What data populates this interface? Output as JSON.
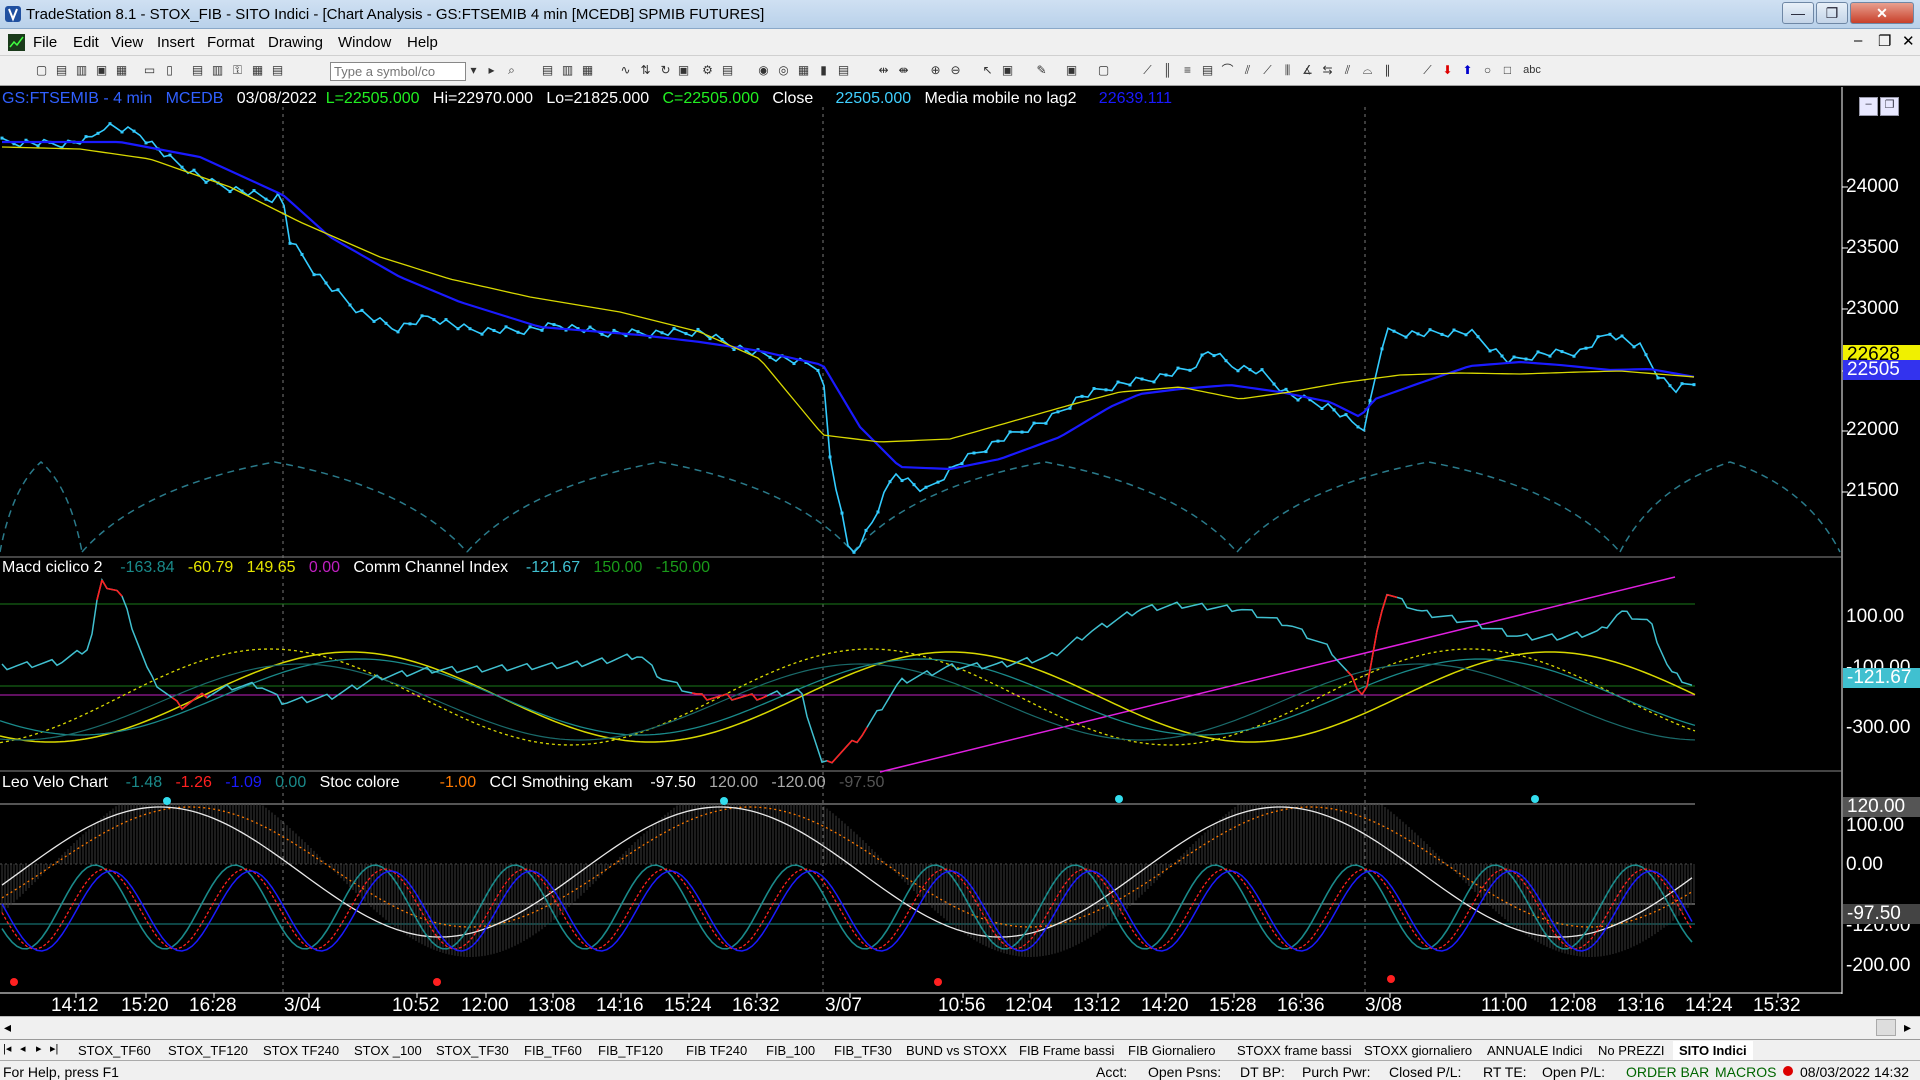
{
  "window": {
    "title": "TradeStation 8.1 - STOX_FIB - SITO Indici - [Chart Analysis - GS:FTSEMIB  4 min  [MCEDB] SPMIB FUTURES]",
    "min": "—",
    "max": "❐",
    "close": "✕",
    "child_min": "–",
    "child_restore": "❐",
    "child_close": "✕"
  },
  "menu": [
    "File",
    "Edit",
    "View",
    "Insert",
    "Format",
    "Drawing",
    "Window",
    "Help"
  ],
  "toolbar": {
    "symbol_placeholder": "Type a symbol/co"
  },
  "header": {
    "symbol": "GS:FTSEMIB - 4 min",
    "feed": "MCEDB",
    "date": "03/08/2022",
    "last": "L=22505.000",
    "hi": "Hi=22970.000",
    "lo": "Lo=21825.000",
    "close_eq": "C=22505.000",
    "close_label": "Close",
    "close_val": "22505.000",
    "ma_label": "Media mobile no lag2",
    "ma_val": "22639.111"
  },
  "panel2": {
    "name": "Macd ciclico 2",
    "v1": "-163.84",
    "v2": "-60.79",
    "v3": "149.65",
    "v4": "0.00",
    "cci_name": "Comm Channel Index",
    "cci1": "-121.67",
    "cci2": "150.00",
    "cci3": "-150.00"
  },
  "panel3": {
    "name": "Leo Velo Chart",
    "v1": "-1.48",
    "v2": "-1.26",
    "v3": "-1.09",
    "v4": "0.00",
    "stoc_name": "Stoc colore",
    "stoc_val": "-1.00",
    "cci_name": "CCI Smothing ekam",
    "c1": "-97.50",
    "c2": "120.00",
    "c3": "-120.00",
    "c4": "-97.50"
  },
  "price_axis": [
    "24000",
    "23500",
    "23000",
    "22500",
    "22000",
    "21500"
  ],
  "price_boxes": {
    "ma": "22628",
    "last": "22505"
  },
  "macd_axis": [
    "100.00",
    "-100.00",
    "-300.00"
  ],
  "macd_box": "-121.67",
  "velo_axis": [
    "120.00",
    "100.00",
    "0.00",
    "-120.00",
    "-200.00"
  ],
  "velo_box": "-97.50",
  "time_axis": [
    "14:12",
    "15:20",
    "16:28",
    "3/04",
    "10:52",
    "12:00",
    "13:08",
    "14:16",
    "15:24",
    "16:32",
    "3/07",
    "10:56",
    "12:04",
    "13:12",
    "14:20",
    "15:28",
    "16:36",
    "3/08",
    "11:00",
    "12:08",
    "13:16",
    "14:24",
    "15:32"
  ],
  "tabs": [
    "STOX_TF60",
    "STOX_TF120",
    "STOX TF240",
    "STOX _100",
    "STOX_TF30",
    "FIB_TF60",
    "FIB_TF120",
    "FIB TF240",
    "FIB_100",
    "FIB_TF30",
    "BUND vs STOXX",
    "FIB Frame bassi",
    "FIB Giornaliero",
    "STOXX frame bassi",
    "STOXX giornaliero",
    "ANNUALE Indici",
    "No PREZZI",
    "SITO Indici"
  ],
  "status": {
    "help": "For Help, press F1",
    "acct": "Acct:",
    "open_psns": "Open Psns:",
    "dt_bp": "DT BP:",
    "purch_pwr": "Purch Pwr:",
    "closed_pl": "Closed P/L:",
    "rt_te": "RT TE:",
    "open_pl": "Open P/L:",
    "order_bar": "ORDER BAR",
    "macros": "MACROS",
    "datetime": "08/03/2022 14:32"
  },
  "colors": {
    "price": "#33ccff",
    "ma_fast": "#1a1aff",
    "ma_slow": "#e6e600",
    "cci": "#40c0d0",
    "cci_red": "#ff2020",
    "magenta": "#e020e0",
    "green_line": "#1a7a1a",
    "white": "#ffffff"
  }
}
